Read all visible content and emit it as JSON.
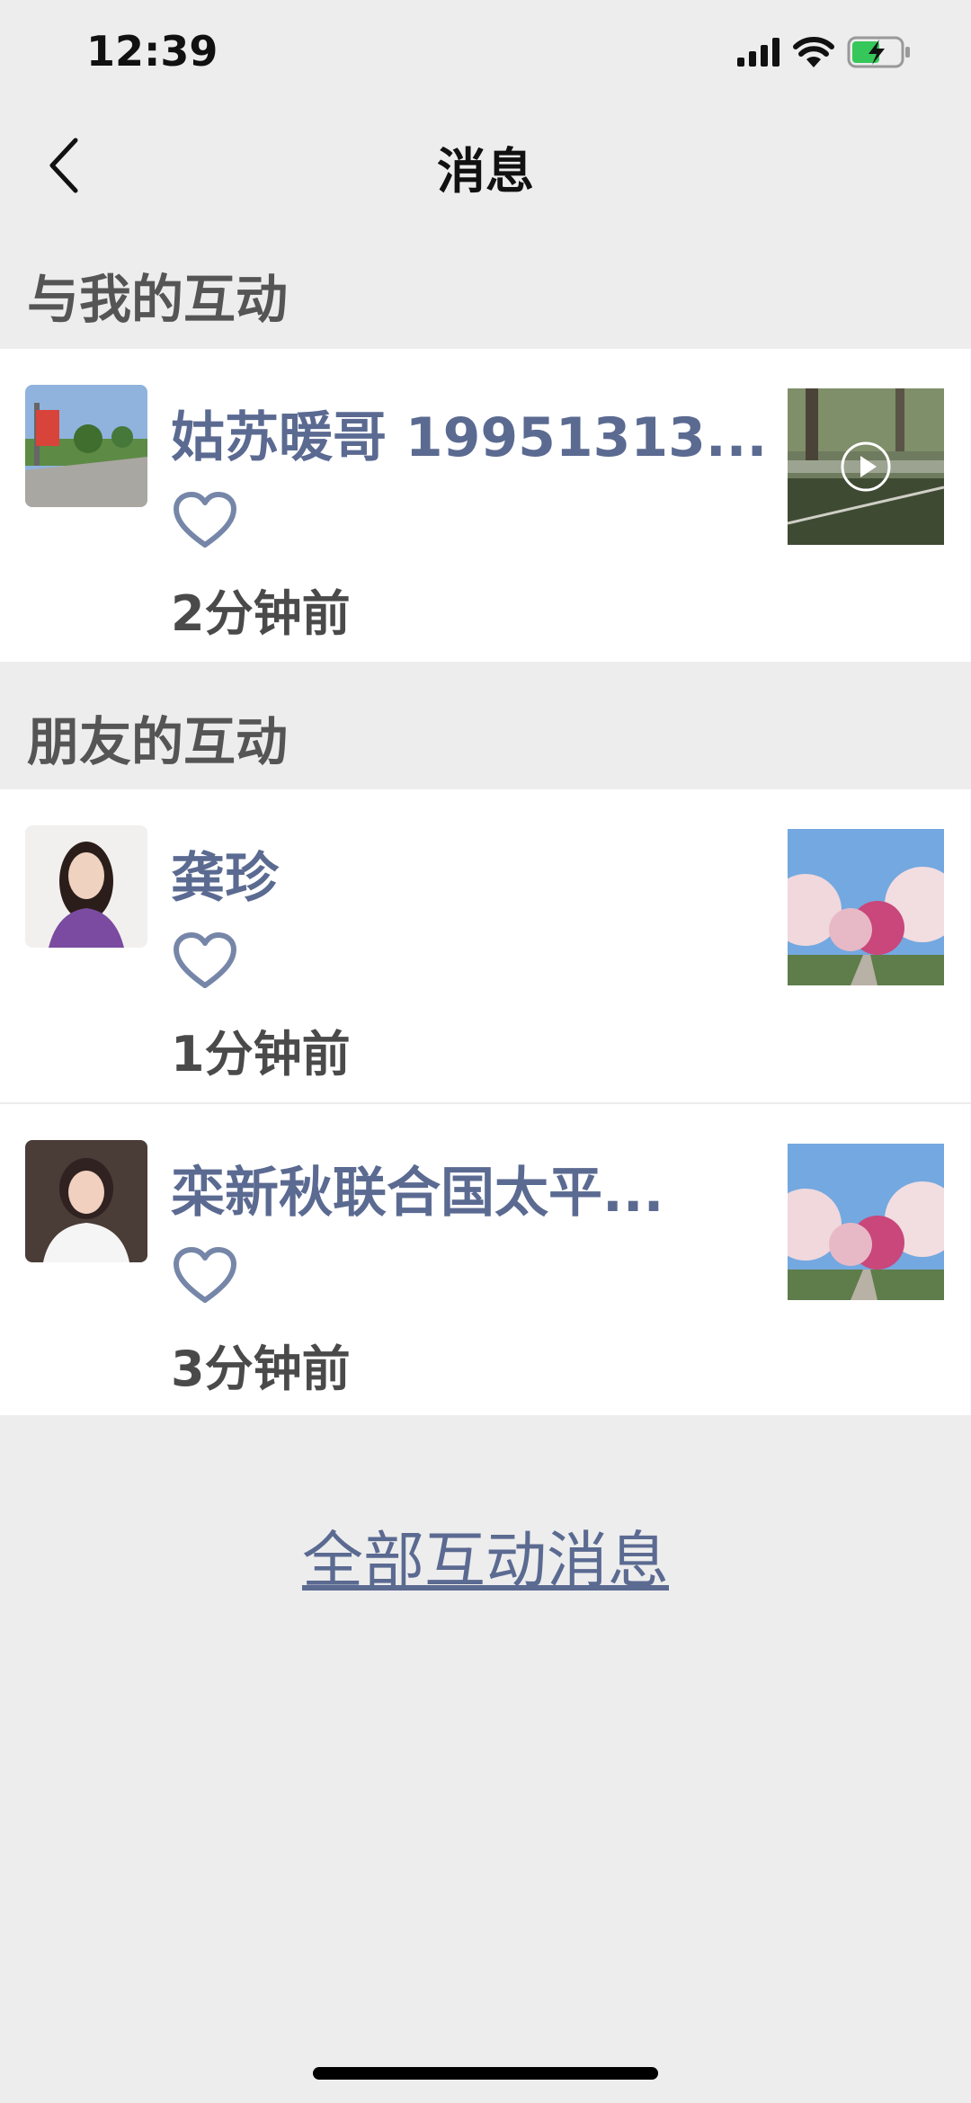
{
  "status": {
    "time": "12:39"
  },
  "nav": {
    "title": "消息"
  },
  "sections": {
    "mine": {
      "title": "与我的互动"
    },
    "friends": {
      "title": "朋友的互动"
    }
  },
  "mine_items": [
    {
      "name": "姑苏暖哥 19951313...",
      "time_ago": "2分钟前",
      "thumb_type": "video"
    }
  ],
  "friend_items": [
    {
      "name": "龚珍",
      "time_ago": "1分钟前",
      "thumb_type": "photo"
    },
    {
      "name": "栾新秋联合国太平...",
      "time_ago": "3分钟前",
      "thumb_type": "photo"
    }
  ],
  "footer": {
    "all_link": "全部互动消息"
  },
  "colors": {
    "accent": "#5b6a91",
    "background": "#ededed",
    "card": "#ffffff",
    "section_text": "#555555"
  }
}
